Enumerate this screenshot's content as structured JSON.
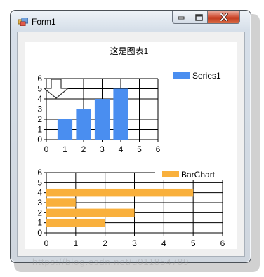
{
  "window": {
    "title": "Form1"
  },
  "watermark": "https://blog.csdn.net/u011854789",
  "chart_data": [
    {
      "type": "bar",
      "title": "这是图表1",
      "x": [
        1,
        2,
        3,
        4
      ],
      "series": [
        {
          "name": "Series1",
          "values": [
            2,
            3,
            4,
            5
          ]
        }
      ],
      "xlim": [
        0,
        6
      ],
      "ylim": [
        0,
        6
      ],
      "xticks": [
        "0",
        "1",
        "2",
        "3",
        "4",
        "5",
        "6"
      ],
      "yticks": [
        "0",
        "1",
        "2",
        "3",
        "4",
        "5",
        "6"
      ],
      "grid": true,
      "legend": "top-right",
      "color": "#4a8ef0"
    },
    {
      "type": "bar",
      "orientation": "horizontal",
      "y": [
        1,
        2,
        3,
        4
      ],
      "series": [
        {
          "name": "BarChart",
          "values": [
            2,
            3,
            1,
            5
          ]
        }
      ],
      "xlim": [
        0,
        6
      ],
      "ylim": [
        0,
        6
      ],
      "xticks": [
        "0",
        "1",
        "2",
        "3",
        "4",
        "5",
        "6"
      ],
      "yticks": [
        "0",
        "1",
        "2",
        "3",
        "4",
        "5",
        "6"
      ],
      "grid": true,
      "legend": "top-right",
      "color": "#f9b03c"
    }
  ]
}
